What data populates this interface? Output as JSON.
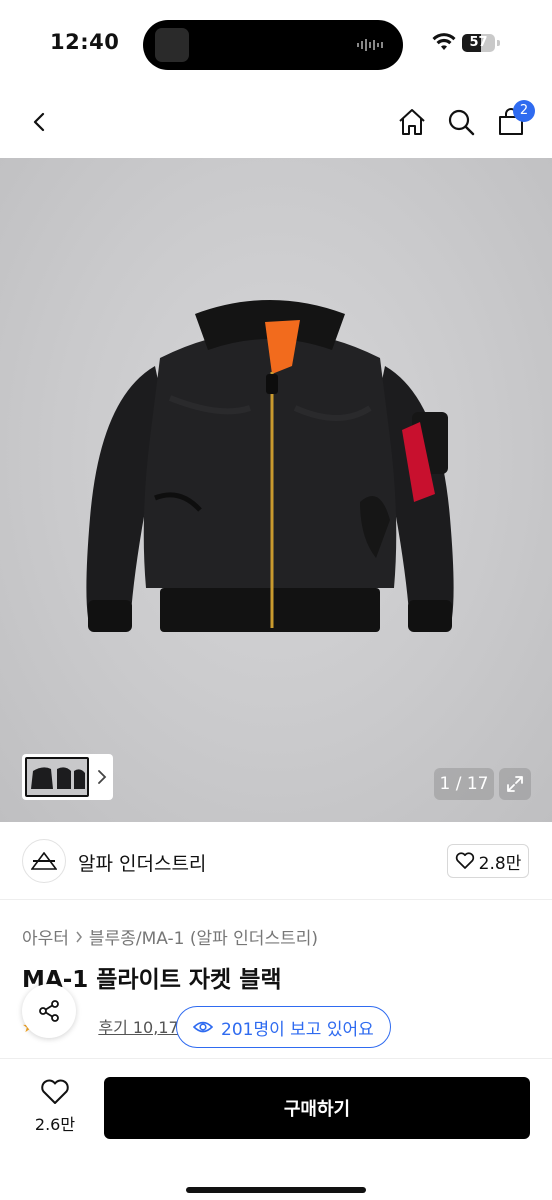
{
  "status_bar": {
    "time": "12:40",
    "battery": "57",
    "battery_level": 0.57
  },
  "header": {
    "cart_badge": "2",
    "icons": [
      "chevron-left-icon",
      "home-icon",
      "search-icon",
      "shopping-bag-icon"
    ]
  },
  "gallery": {
    "counter": "1 / 17",
    "icons": [
      "chevron-right-icon",
      "expand-icon"
    ]
  },
  "brand": {
    "name": "알파 인더스트리",
    "like_count": "2.8만"
  },
  "product": {
    "breadcrumb": [
      "아우터",
      "블루종/MA-1 (알파 인더스트리)"
    ],
    "title": "MA-1 플라이트 자켓 블랙",
    "reviews": "후기 10,173개",
    "viewers": "201명이 보고 있어요"
  },
  "bottom_bar": {
    "wish_count": "2.6만",
    "buy_label": "구매하기"
  },
  "colors": {
    "accent": "#2f6bf0",
    "buy_button": "#000000",
    "lining": "#f26b1d",
    "tag": "#c8102e"
  }
}
